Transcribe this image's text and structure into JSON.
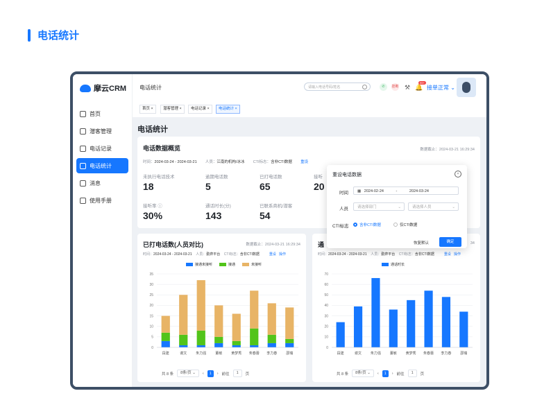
{
  "page_title": "电话统计",
  "app": {
    "logo": "摩云CRM",
    "breadcrumb": "电话统计",
    "search_placeholder": "请输入电话号码/姓名",
    "status": "接单正常",
    "notification_badge": "99+",
    "hangup_label": "挂断",
    "sidebar": [
      {
        "label": "首页",
        "icon": "home-icon"
      },
      {
        "label": "潜客管理",
        "icon": "users-icon"
      },
      {
        "label": "电话记录",
        "icon": "phone-icon"
      },
      {
        "label": "电话统计",
        "icon": "bar-chart-icon",
        "active": true
      },
      {
        "label": "消息",
        "icon": "message-icon"
      },
      {
        "label": "使用手册",
        "icon": "book-icon"
      }
    ],
    "tabs": [
      {
        "label": "首页"
      },
      {
        "label": "潜客管理"
      },
      {
        "label": "电话记录"
      },
      {
        "label": "电话统计",
        "active": true
      }
    ],
    "accent_color": "#1677ff"
  },
  "section_title": "电话统计",
  "overview": {
    "title": "电话数据概览",
    "deadline": "数据截止：2024-03-21 16:29:34",
    "time_label": "时间：",
    "time_value": "2024-03-24 - 2024-03-21",
    "person_label": "人员：",
    "person_value": "江南的机构/冰冰",
    "cti_label": "CTI标志：",
    "cti_value": "含非CTI数据",
    "reset": "重设",
    "stats": [
      {
        "label": "未执行电话技术",
        "value": "18"
      },
      {
        "label": "逾期电话数",
        "value": "5"
      },
      {
        "label": "已打电话数",
        "value": "65"
      },
      {
        "label": "接听",
        "value": "20"
      },
      {
        "label": "接听率",
        "value": "30%"
      },
      {
        "label": "通话时长(分)",
        "value": "143"
      },
      {
        "label": "已联系商机/潜客",
        "value": "54"
      }
    ]
  },
  "chart1": {
    "title": "已打电话数(人员对比)",
    "deadline": "数据截止：2024-03-21 16:29:34",
    "meta": {
      "time_label": "时间：",
      "time": "2024-03-24 - 2024-03-21",
      "person_label": "人员：",
      "person": "勤弈平台",
      "cti_label": "CTI标志：",
      "cti": "含非CTI数据",
      "reset": "重设",
      "action": "操作"
    },
    "pager": {
      "total": "共 8 条",
      "size": "8条/页",
      "page": "1",
      "goto": "前往",
      "goto_page": "1",
      "unit": "页"
    }
  },
  "chart2": {
    "title_partial": "通",
    "deadline_partial": "34",
    "meta": {
      "time_label": "时间：",
      "time": "2024-03-24 - 2024-03-21",
      "person_label": "人员：",
      "person": "勤弈平台",
      "cti_label": "CTI标志：",
      "cti": "含非CTI数据",
      "reset": "重设",
      "action": "操作"
    },
    "pager": {
      "total": "共 8 条",
      "size": "8条/页",
      "page": "1",
      "goto": "前往",
      "goto_page": "1",
      "unit": "页"
    }
  },
  "popup": {
    "title": "重设电话数据",
    "time_label": "时间",
    "date_start": "2024-02-24",
    "date_sep": "-",
    "date_end": "2024-03-24",
    "person_label": "人员",
    "dept_placeholder": "请选择部门",
    "person_placeholder": "请选择人员",
    "cti_label": "CTI标志",
    "cti_option1": "含非CTI数据",
    "cti_option2": "仅CTI数据",
    "restore": "恢复默认",
    "confirm": "确定"
  },
  "chart_data": [
    {
      "type": "bar",
      "stacked": true,
      "categories": [
        "段建",
        "谢文",
        "朱力强",
        "董敏",
        "黄梦秀",
        "朱春蕾",
        "李力春",
        "邵瑞"
      ],
      "series": [
        {
          "name": "接通未接听",
          "color": "#1677ff",
          "values": [
            3,
            1,
            1,
            2,
            1,
            1,
            2,
            2
          ]
        },
        {
          "name": "接通",
          "color": "#52c41a",
          "values": [
            4,
            5,
            7,
            3,
            2,
            8,
            4,
            2
          ]
        },
        {
          "name": "未接听",
          "color": "#e8b466",
          "values": [
            8,
            19,
            24,
            15,
            13,
            18,
            15,
            15
          ]
        }
      ],
      "ylim": [
        0,
        35
      ],
      "yticks": [
        0,
        5,
        10,
        15,
        20,
        25,
        30,
        35
      ],
      "grid": true,
      "legend": "top"
    },
    {
      "type": "bar",
      "categories": [
        "段建",
        "谢文",
        "朱力强",
        "董敏",
        "黄梦秀",
        "朱春蕾",
        "李力春",
        "邵瑞"
      ],
      "series": [
        {
          "name": "通话时长",
          "color": "#1677ff",
          "values": [
            24,
            39,
            66,
            36,
            45,
            54,
            48,
            34
          ]
        }
      ],
      "ylim": [
        0,
        70
      ],
      "yticks": [
        0,
        10,
        20,
        30,
        40,
        50,
        60,
        70
      ],
      "grid": true,
      "legend": "top"
    }
  ]
}
